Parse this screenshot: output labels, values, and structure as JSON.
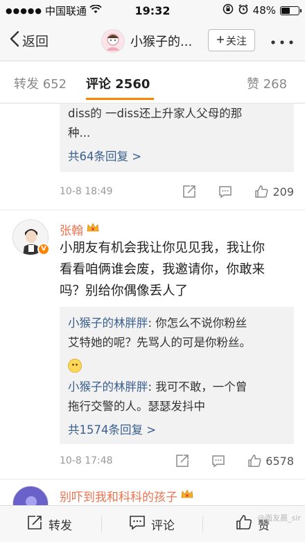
{
  "status_bar": {
    "carrier": "中国联通",
    "time": "19:32",
    "battery": "48%",
    "battery_level": 0.48
  },
  "nav": {
    "back_label": "返回",
    "title": "小猴子的...",
    "follow_label": "关注"
  },
  "tabs": [
    {
      "label": "转发 652"
    },
    {
      "label": "评论 2560"
    },
    {
      "label": "赞 268"
    }
  ],
  "comments": [
    {
      "replies": [
        {
          "text": "diss的 一diss还上升家人父母的那"
        },
        {
          "text": "种..."
        }
      ],
      "more_replies": "共64条回复 >",
      "time": "10-8 18:49",
      "likes": "209"
    },
    {
      "user": "张翰",
      "text_lines": [
        "小朋友有机会我让你见见我，我让你",
        "看看咱俩谁会废，我邀请你，你敢来",
        "吗？别给你偶像丢人了"
      ],
      "replies": [
        {
          "user": "小猴子的林胖胖",
          "line1": ": 你怎么不说你粉丝",
          "line2": "艾特她的呢？先骂人的可是你粉丝。"
        },
        {
          "user": "小猴子的林胖胖",
          "line1": ": 我可不敢，一个曾",
          "line2": "拖行交警的人。瑟瑟发抖中"
        }
      ],
      "more_replies": "共1574条回复 >",
      "time": "10-8 17:48",
      "likes": "6578"
    },
    {
      "user": "别吓到我和科科的孩子"
    }
  ],
  "bottom_bar": {
    "repost": "转发",
    "comment": "评论",
    "like": "赞"
  },
  "watermark": "@面友晨_sir",
  "colors": {
    "accent": "#ff8200",
    "username": "#eb7350",
    "link": "#3a5f8f"
  }
}
